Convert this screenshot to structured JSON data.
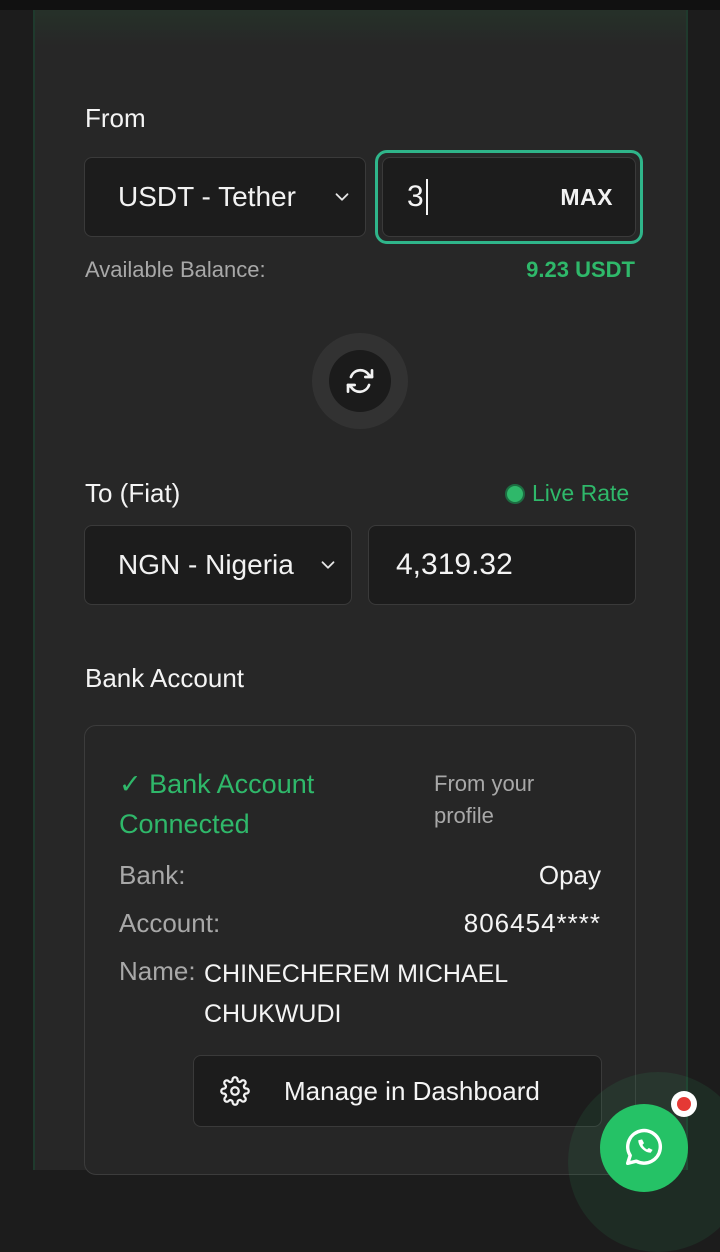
{
  "from": {
    "label": "From",
    "currency_select": "USDT - Tether",
    "amount": "3",
    "max_label": "MAX",
    "balance_label": "Available Balance:",
    "balance_value": "9.23 USDT"
  },
  "to": {
    "label": "To (Fiat)",
    "live_rate_label": "Live Rate",
    "currency_select": "NGN - Nigeria",
    "amount": "4,319.32"
  },
  "bank": {
    "label": "Bank Account",
    "connected_label": "✓ Bank Account Connected",
    "source_note": "From your profile",
    "bank_key": "Bank:",
    "bank_value": "Opay",
    "account_key": "Account:",
    "account_value": "806454****",
    "name_key": "Name:",
    "name_value": "CHINECHEREM MICHAEL CHUKWUDI",
    "manage_button": "Manage in Dashboard"
  },
  "colors": {
    "accent_green": "#2fb86a",
    "focus_teal": "#2fb58a",
    "whatsapp_green": "#25c266"
  }
}
